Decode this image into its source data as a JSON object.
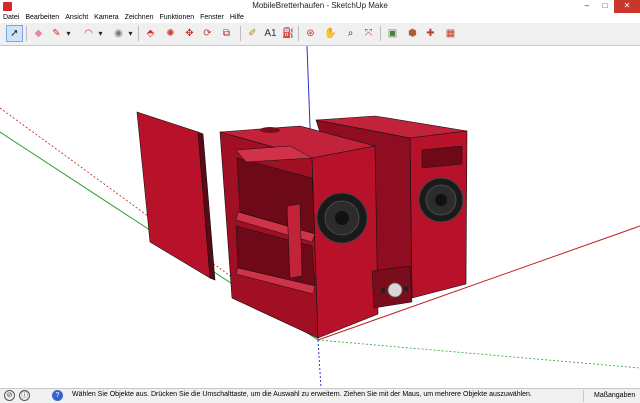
{
  "window": {
    "title": "MobileBretterhaufen - SketchUp Make",
    "controls": {
      "minimize": "–",
      "maximize": "□",
      "close": "✕"
    }
  },
  "menu": [
    "Datei",
    "Bearbeiten",
    "Ansicht",
    "Kamera",
    "Zeichnen",
    "Funktionen",
    "Fenster",
    "Hilfe"
  ],
  "toolbar": {
    "tools": [
      {
        "name": "select-tool",
        "glyph": "➚",
        "color": "#1a1a1a",
        "selected": true
      },
      {
        "name": "eraser-tool",
        "glyph": "◆",
        "color": "#e087a8"
      },
      {
        "name": "pencil-line-tool",
        "glyph": "✎",
        "color": "#c0392b"
      },
      {
        "name": "dropdown",
        "glyph": "▾",
        "color": "#222"
      },
      {
        "name": "arc-tool",
        "glyph": "◠",
        "color": "#c0392b"
      },
      {
        "name": "dropdown",
        "glyph": "▾",
        "color": "#222"
      },
      {
        "name": "shape-tool",
        "glyph": "◉",
        "color": "#7a7a7a"
      },
      {
        "name": "dropdown",
        "glyph": "▾",
        "color": "#222"
      },
      {
        "name": "push-pull-tool",
        "glyph": "⬘",
        "color": "#c0392b"
      },
      {
        "name": "follow-me-tool",
        "glyph": "✺",
        "color": "#d23b2a"
      },
      {
        "name": "move-tool",
        "glyph": "✥",
        "color": "#c0392b"
      },
      {
        "name": "rotate-tool",
        "glyph": "⟳",
        "color": "#c0392b"
      },
      {
        "name": "scale-tool",
        "glyph": "⧉",
        "color": "#b03030"
      },
      {
        "name": "tape-measure-tool",
        "glyph": "✐",
        "color": "#b8860b"
      },
      {
        "name": "text-tool",
        "glyph": "A1",
        "color": "#333"
      },
      {
        "name": "paint-bucket-tool",
        "glyph": "⛽",
        "color": "#c8a020"
      },
      {
        "name": "orbit-tool",
        "glyph": "⊛",
        "color": "#c0392b"
      },
      {
        "name": "pan-tool",
        "glyph": "✋",
        "color": "#c07030"
      },
      {
        "name": "zoom-tool",
        "glyph": "⌕",
        "color": "#2a2a2a"
      },
      {
        "name": "zoom-extents-tool",
        "glyph": "⤧",
        "color": "#c0392b"
      },
      {
        "name": "warehouse-tool",
        "glyph": "▣",
        "color": "#4a7d3a"
      },
      {
        "name": "share-model-tool",
        "glyph": "⬢",
        "color": "#b06030"
      },
      {
        "name": "extension-warehouse-tool",
        "glyph": "✚",
        "color": "#c0392b"
      },
      {
        "name": "extension-manager-tool",
        "glyph": "▦",
        "color": "#c0392b"
      }
    ]
  },
  "statusbar": {
    "message": "Wählen Sie Objekte aus. Drücken Sie die Umschalttaste, um die Auswahl zu erweitern. Ziehen Sie mit der Maus, um mehrere Objekte auszuwählen.",
    "measurements_label": "Maßangaben",
    "icons": [
      {
        "name": "geolocation-icon",
        "glyph": "⊘"
      },
      {
        "name": "credits-icon",
        "glyph": "ⓘ"
      },
      {
        "name": "help-icon",
        "glyph": "?"
      }
    ]
  },
  "colors": {
    "model_red": "#b8112a",
    "model_red_dark": "#7a0c1c",
    "model_red_light": "#d03348",
    "axis_red": "#c02020",
    "axis_green": "#2fa02f",
    "axis_blue": "#3030d0"
  }
}
